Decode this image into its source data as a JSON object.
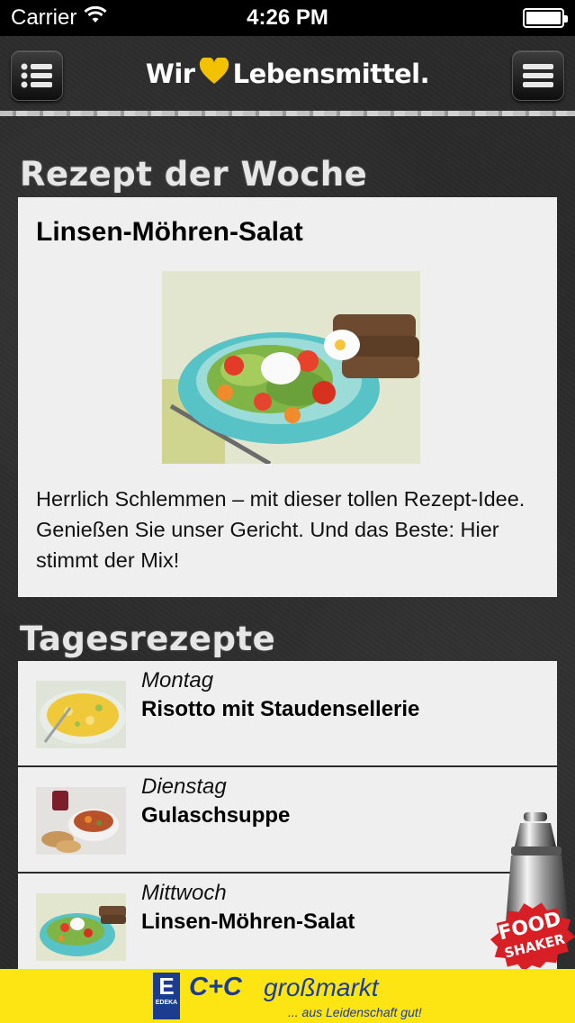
{
  "status_bar": {
    "carrier": "Carrier",
    "time": "4:26 PM"
  },
  "nav": {
    "logo_left": "Wir",
    "logo_right": "Lebensmittel."
  },
  "recipe_of_week": {
    "section_title": "Rezept der Woche",
    "title": "Linsen-Möhren-Salat",
    "description": "Herrlich Schlemmen – mit dieser tollen Rezept-Idee. Genießen Sie unser Gericht. Und das Beste: Hier stimmt der Mix!"
  },
  "daily": {
    "section_title": "Tagesrezepte",
    "items": [
      {
        "day": "Montag",
        "dish": "Risotto mit Staudensellerie"
      },
      {
        "day": "Dienstag",
        "dish": "Gulaschsuppe"
      },
      {
        "day": "Mittwoch",
        "dish": "Linsen-Möhren-Salat"
      }
    ]
  },
  "food_shaker": {
    "line1": "FOOD",
    "line2": "SHAKER"
  },
  "banner": {
    "edeka_letter": "E",
    "edeka_small": "EDEKA",
    "cc": "C+C",
    "grossmarkt": "großmarkt",
    "slogan": "... aus Leidenschaft gut!"
  },
  "colors": {
    "background": "#2b2b2b",
    "card": "#efeff0",
    "heart": "#f2c200",
    "banner": "#fde514",
    "brand_blue": "#1b3c8f"
  }
}
